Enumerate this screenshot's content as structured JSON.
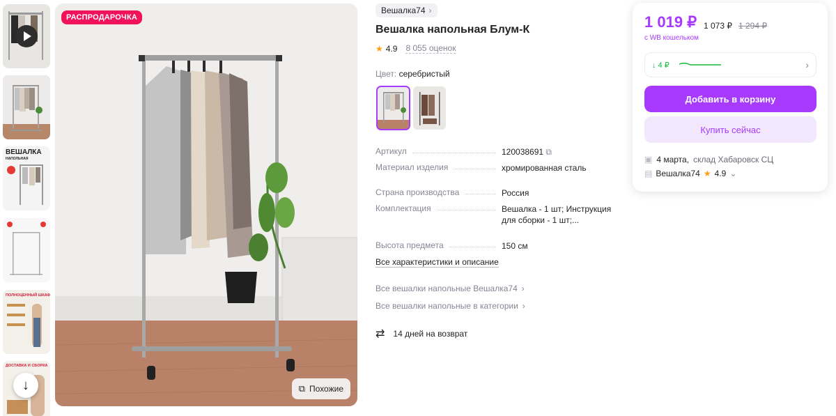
{
  "badge": {
    "sale": "РАСПРОДАРОЧКА"
  },
  "similar": {
    "label": "Похожие"
  },
  "thumbnails": [
    {
      "name": "video-thumb"
    },
    {
      "name": "photo-hanger"
    },
    {
      "name": "photo-infographic",
      "caption": "ВЕШАЛКА",
      "sub": "НАПОЛЬНАЯ"
    },
    {
      "name": "photo-dimensions"
    },
    {
      "name": "photo-closet",
      "caption": "ПОЛНОЦЕННЫЙ ШКАФ"
    },
    {
      "name": "photo-delivery",
      "caption": "ДОСТАВКА И СБОРКА"
    }
  ],
  "product": {
    "brand": "Вешалка74",
    "title": "Вешалка напольная Блум-К",
    "rating": "4.9",
    "reviews": "8 055 оценок",
    "color_label": "Цвет:",
    "color_value": "серебристый"
  },
  "properties": [
    {
      "key": "Артикул",
      "value": "120038691"
    },
    {
      "key": "Материал изделия",
      "value": "хромированная сталь"
    },
    {
      "key": "Страна производства",
      "value": "Россия"
    },
    {
      "key": "Комплектация",
      "value": "Вешалка - 1 шт; Инструкция для сборки - 1 шт;..."
    },
    {
      "key": "Высота предмета",
      "value": "150 см"
    }
  ],
  "links": {
    "all_chars": "Все характеристики и описание",
    "brand_cat": "Все вешалки напольные Вешалка74",
    "category": "Все вешалки напольные в категории"
  },
  "returns": {
    "text": "14 дней на возврат"
  },
  "buy": {
    "price": "1 019 ₽",
    "price_regular": "1 073 ₽",
    "price_old": "1 294 ₽",
    "wallet_note": "с WB кошельком",
    "history": "↓ 4 ₽",
    "add_to_cart": "Добавить в корзину",
    "buy_now": "Купить сейчас",
    "delivery_date": "4 марта,",
    "delivery_place": "склад Хабаровск СЦ",
    "seller": "Вешалка74",
    "seller_rating": "4.9"
  },
  "colors": {
    "accent": "#a73afd",
    "sale": "#f0135c",
    "star": "#ff9e0d",
    "green": "#14b83b"
  }
}
